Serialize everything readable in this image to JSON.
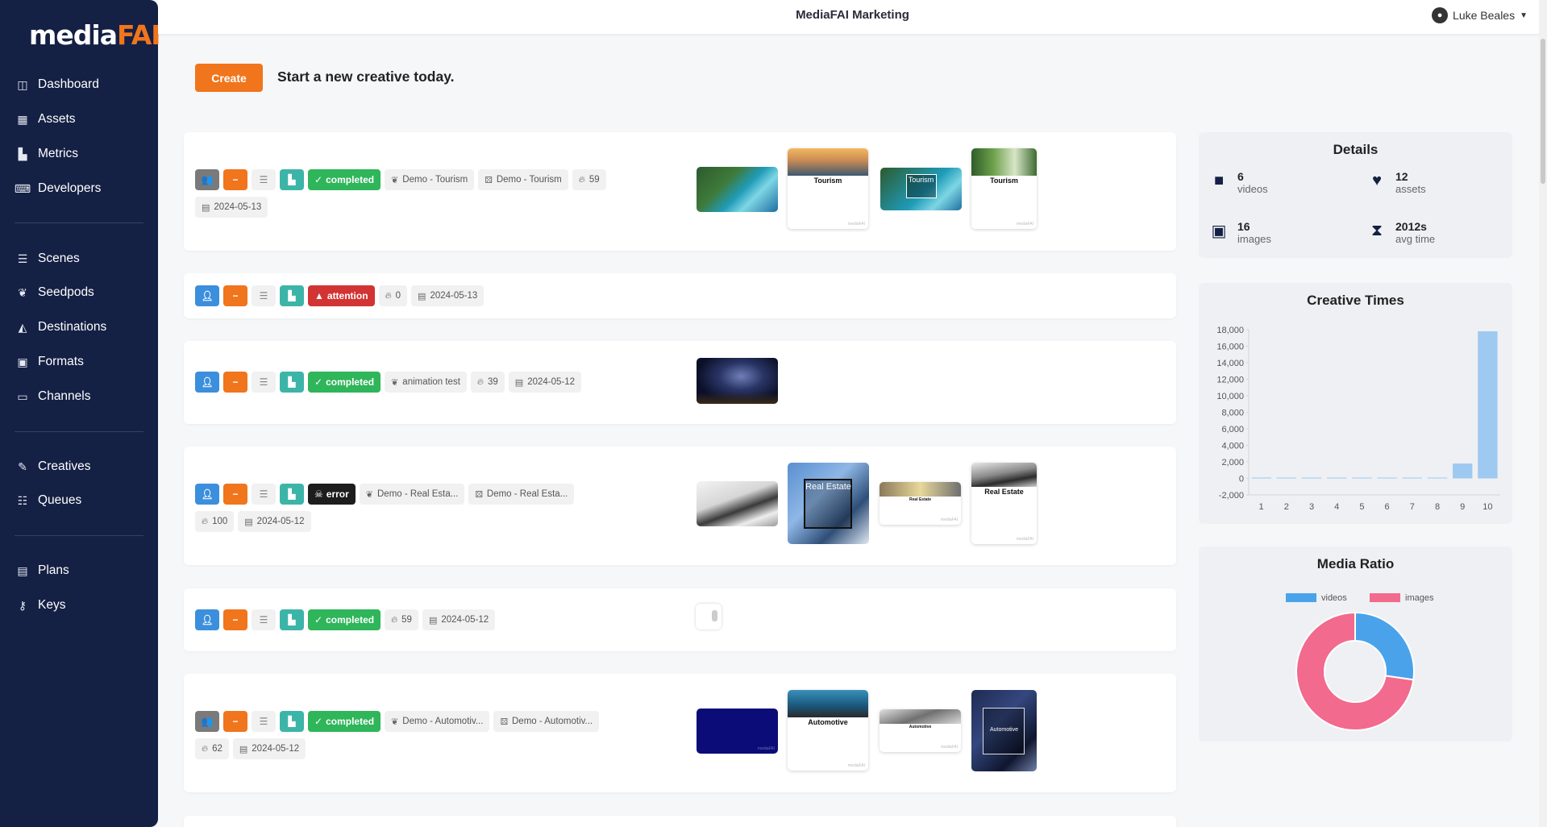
{
  "app": {
    "logo_prefix": "media",
    "logo_suffix": "FAI",
    "title": "MediaFAI Marketing",
    "user_name": "Luke Beales"
  },
  "nav": {
    "dashboard": "Dashboard",
    "assets": "Assets",
    "metrics": "Metrics",
    "developers": "Developers",
    "scenes": "Scenes",
    "seedpods": "Seedpods",
    "destinations": "Destinations",
    "formats": "Formats",
    "channels": "Channels",
    "creatives": "Creatives",
    "queues": "Queues",
    "plans": "Plans",
    "keys": "Keys"
  },
  "create": {
    "button": "Create",
    "tagline": "Start a new creative today."
  },
  "creatives": [
    {
      "status": "completed",
      "seedpod": "Demo - Tourism",
      "scene": "Demo - Tourism",
      "count": "59",
      "date": "2024-05-13",
      "thumb_label": "Tourism"
    },
    {
      "status": "attention",
      "count": "0",
      "date": "2024-05-13"
    },
    {
      "status": "completed",
      "seedpod": "animation test",
      "count": "39",
      "date": "2024-05-12"
    },
    {
      "status": "error",
      "seedpod": "Demo - Real Esta...",
      "scene": "Demo - Real Esta...",
      "count": "100",
      "date": "2024-05-12",
      "thumb_label": "Real Estate"
    },
    {
      "status": "completed",
      "count": "59",
      "date": "2024-05-12"
    },
    {
      "status": "completed",
      "seedpod": "Demo - Automotiv...",
      "scene": "Demo - Automotiv...",
      "count": "62",
      "date": "2024-05-12",
      "thumb_label": "Automotive"
    }
  ],
  "details": {
    "title": "Details",
    "videos_value": "6",
    "videos_label": "videos",
    "assets_value": "12",
    "assets_label": "assets",
    "images_value": "16",
    "images_label": "images",
    "avg_value": "2012s",
    "avg_label": "avg time"
  },
  "chart_data": [
    {
      "type": "bar",
      "title": "Creative Times",
      "categories": [
        "1",
        "2",
        "3",
        "4",
        "5",
        "6",
        "7",
        "8",
        "9",
        "10"
      ],
      "values": [
        100,
        0,
        50,
        80,
        60,
        80,
        40,
        30,
        1800,
        17800
      ],
      "ylim": [
        -2000,
        18000
      ],
      "yticks": [
        "18,000",
        "16,000",
        "14,000",
        "12,000",
        "10,000",
        "8,000",
        "6,000",
        "4,000",
        "2,000",
        "0",
        "-2,000"
      ],
      "color": "#9ec9f0",
      "grid": false
    },
    {
      "type": "pie",
      "title": "Media Ratio",
      "labels": [
        "videos",
        "images"
      ],
      "values": [
        6,
        16
      ],
      "colors": [
        "#4aa3ea",
        "#f26a8d"
      ],
      "legend": "top"
    }
  ]
}
